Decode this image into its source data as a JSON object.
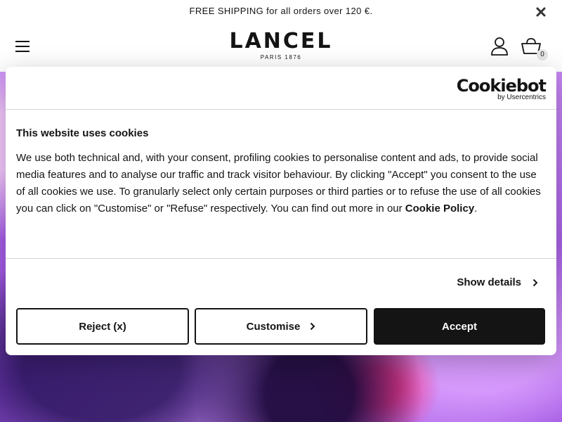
{
  "promo": {
    "text": "FREE SHIPPING for all orders over 120 €."
  },
  "header": {
    "logo_main": "LANCEL",
    "logo_sub": "PARIS 1876",
    "cart_count": "0"
  },
  "cookie_banner": {
    "provider_logo_main": "Cookiebot",
    "provider_logo_sub": "by Usercentrics",
    "title": "This website uses cookies",
    "body": "We use both technical and, with your consent, profiling cookies to personalise content and ads, to provide social media features and to analyse our traffic and track visitor behaviour. By clicking \"Accept\" you consent to the use of all cookies we use. To granularly select only certain purposes or third parties or to refuse the use of all cookies you can click on \"Customise\" or \"Refuse\" respectively. You can find out more in our ",
    "policy_link": "Cookie Policy",
    "body_end": ".",
    "show_details": "Show details",
    "reject_label": "Reject (x)",
    "customise_label": "Customise",
    "accept_label": "Accept"
  },
  "colors": {
    "text": "#141414",
    "accept_bg": "#141414",
    "divider": "#d6d6d6",
    "hero_accent": "#b56ef0"
  },
  "icons": [
    "close-icon",
    "hamburger-menu-icon",
    "user-icon",
    "cart-icon",
    "chevron-right-icon"
  ]
}
